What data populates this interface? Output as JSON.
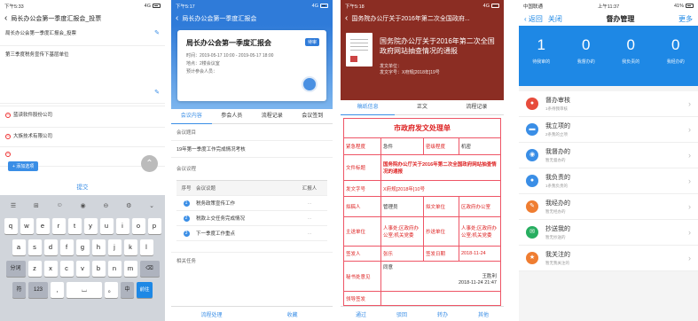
{
  "p1": {
    "status_time": "下午5:33",
    "status_net": "4G",
    "title": "局长办公会第一季度汇报会_投票",
    "field1": "局长办公会第一季度汇报会_投票",
    "field2": "第三季度税务宣传下基层单位",
    "list": [
      "蓝读软件股份公司",
      "大族技术有限公司"
    ],
    "add_label": "+ 添加选项",
    "submit": "提交",
    "kb_row1": [
      "q",
      "w",
      "e",
      "r",
      "t",
      "y",
      "u",
      "i",
      "o",
      "p"
    ],
    "kb_row2": [
      "a",
      "s",
      "d",
      "f",
      "g",
      "h",
      "j",
      "k",
      "l"
    ],
    "kb_row3": [
      "z",
      "x",
      "c",
      "v",
      "b",
      "n",
      "m"
    ],
    "kb_seg": "分词",
    "kb_num": "123",
    "kb_sym": "符",
    "kb_go": "前往"
  },
  "p2": {
    "status_time": "下午5:17",
    "title": "局长办公会第一季度汇报会",
    "card_title": "局长办公会第一季度汇报会",
    "badge": "待审",
    "time_line": "时间：2019-05-17 10:00 - 2019-05-17 18:00",
    "place_line": "地点：2楼会议室",
    "people_line": "预计参会人员：",
    "tabs": [
      "会议内容",
      "参会人员",
      "流程记录",
      "会议签到"
    ],
    "topic_label": "会议题目",
    "topic": "19年第一季度工作完成情况考核",
    "agenda_label": "会议议程",
    "table_head": [
      "序号",
      "会议议题",
      "汇报人"
    ],
    "rows": [
      {
        "n": "1",
        "t": "税务政策宣传工作",
        "p": "..."
      },
      {
        "n": "2",
        "t": "税款上交任务完成情况",
        "p": "..."
      },
      {
        "n": "3",
        "t": "下一季度工作重点",
        "p": "..."
      }
    ],
    "related": "相关任务",
    "btn_flow": "流程处理",
    "btn_fav": "收藏"
  },
  "p3": {
    "status_time": "下午5:18",
    "title": "国务院办公厅关于2016年第二次全国政府...",
    "head_title": "国务院办公厅关于2016年第二次全国政府网站抽查情况的通报",
    "head_unit": "发文单位：",
    "head_no": "发文字号：X府规[2018年]19号",
    "tabs": [
      "稿纸信息",
      "正文",
      "流程记录"
    ],
    "form_title": "市政府发文处理单",
    "r1": [
      "紧急程度",
      "急件",
      "密级程度",
      "机密"
    ],
    "r2_label": "文件标题",
    "r2_value": "国务院办公厅关于2016年第二次全国政府网站抽查情况的通报",
    "r3_label": "发文字号",
    "r3_value": "X府规[2018年]10号",
    "r4": [
      "拟稿人",
      "管理员",
      "拟文单位",
      "区政府办公室"
    ],
    "r5": [
      "主送单位",
      "人事处;区政府办公室;机关党委",
      "抄送单位",
      "人事处;区政府办公室;机关党委"
    ],
    "r6": [
      "签发人",
      "张乐",
      "签发日期",
      "2018-11-24"
    ],
    "r7_label": "秘书处意见",
    "r7_opinion": "同意",
    "r7_sign": "王胜利",
    "r7_time": "2018-11-24 21:47",
    "r8_label": "领导签发",
    "bottom": [
      "通过",
      "驳回",
      "转办",
      "其他"
    ]
  },
  "p4": {
    "status_left": "中国联通",
    "status_time": "上午11:37",
    "battery": "41%",
    "back": "返回",
    "close": "关闭",
    "title": "督办管理",
    "more": "更多",
    "stats": [
      {
        "n": "1",
        "c": "待我审的"
      },
      {
        "n": "0",
        "c": "我督办的"
      },
      {
        "n": "0",
        "c": "我负责的"
      },
      {
        "n": "0",
        "c": "我经办的"
      }
    ],
    "items": [
      {
        "a": "督办审核",
        "b": "1条待我审核",
        "color": "#e74c3c",
        "icon": "person-icon"
      },
      {
        "a": "我立项的",
        "b": "2条我的立项",
        "color": "#3a8ee6",
        "icon": "folder-icon"
      },
      {
        "a": "我督办的",
        "b": "暂无督办的",
        "color": "#3a8ee6",
        "icon": "eye-icon"
      },
      {
        "a": "我负责的",
        "b": "1条我负责的",
        "color": "#3a8ee6",
        "icon": "person-icon"
      },
      {
        "a": "我经办的",
        "b": "暂无经办的",
        "color": "#ef7d31",
        "icon": "pen-icon"
      },
      {
        "a": "抄送我的",
        "b": "暂无抄送的",
        "color": "#27ae60",
        "icon": "mail-icon"
      },
      {
        "a": "我关注的",
        "b": "暂无我关注的",
        "color": "#ef7d31",
        "icon": "star-icon"
      }
    ]
  }
}
